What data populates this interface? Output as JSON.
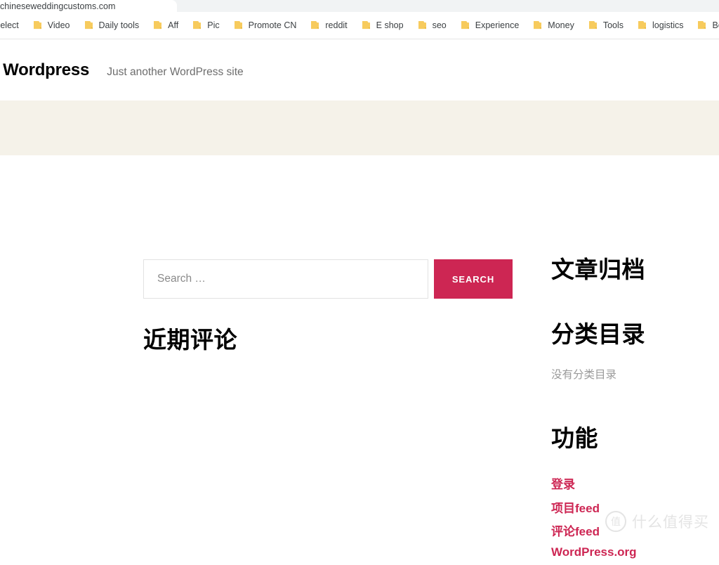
{
  "browser": {
    "tab": {
      "title": "chineseweddingcustoms.com"
    },
    "bookmarks": [
      {
        "label": "Select",
        "icon": "folder-icon",
        "truncated": true
      },
      {
        "label": "Video",
        "icon": "folder-icon"
      },
      {
        "label": "Daily tools",
        "icon": "folder-icon"
      },
      {
        "label": "Aff",
        "icon": "folder-icon"
      },
      {
        "label": "Pic",
        "icon": "folder-icon"
      },
      {
        "label": "Promote CN",
        "icon": "folder-icon"
      },
      {
        "label": "reddit",
        "icon": "folder-icon"
      },
      {
        "label": "E shop",
        "icon": "folder-icon"
      },
      {
        "label": "seo",
        "icon": "folder-icon"
      },
      {
        "label": "Experience",
        "icon": "folder-icon"
      },
      {
        "label": "Money",
        "icon": "folder-icon"
      },
      {
        "label": "Tools",
        "icon": "folder-icon"
      },
      {
        "label": "logistics",
        "icon": "folder-icon"
      },
      {
        "label": "Bolgs",
        "icon": "folder-icon"
      },
      {
        "label": "",
        "icon": "folder-icon"
      }
    ]
  },
  "site": {
    "title": "ly Wordpress",
    "description": "Just another WordPress site"
  },
  "search": {
    "placeholder": "Search …",
    "value": "",
    "button_label": "SEARCH"
  },
  "widgets": {
    "recent_comments": {
      "heading": "近期评论"
    },
    "archives": {
      "heading": "文章归档"
    },
    "categories": {
      "heading": "分类目录",
      "empty_note": "没有分类目录"
    },
    "meta": {
      "heading": "功能",
      "links": [
        {
          "label": "登录"
        },
        {
          "label": "项目feed"
        },
        {
          "label": "评论feed"
        },
        {
          "label": "WordPress.org"
        }
      ]
    }
  },
  "watermark": {
    "logo_glyph": "值",
    "text": "什么值得买"
  },
  "colors": {
    "accent": "#cd2653",
    "banner": "#f5f2e9",
    "tab_strip": "#f1f3f4",
    "muted_text": "#9a9a9a",
    "watermark": "#e4e4e4"
  }
}
